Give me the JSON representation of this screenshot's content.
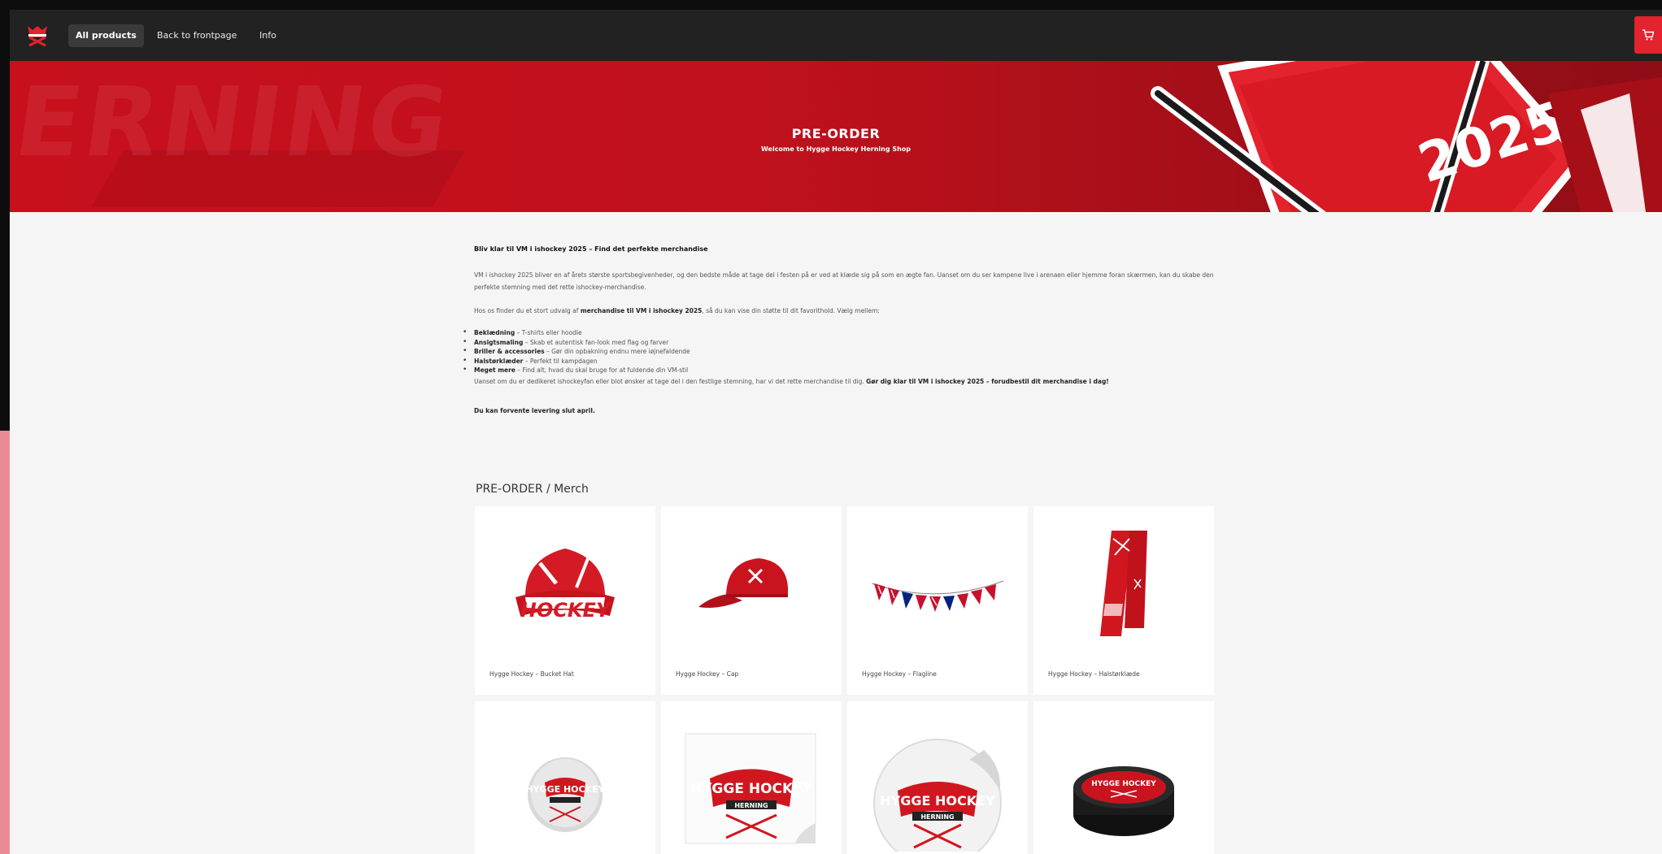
{
  "nav": {
    "links": [
      "All products",
      "Back to frontpage",
      "Info"
    ],
    "cart_icon": "cart-icon"
  },
  "hero": {
    "bg_text": "ERNING",
    "badge_year": "2025",
    "title": "PRE-ORDER",
    "subtitle": "Welcome to Hygge Hockey Herning Shop"
  },
  "intro": {
    "heading": "Bliv klar til VM i ishockey 2025 – Find det perfekte merchandise",
    "p1": "VM i ishockey 2025 bliver en af årets største sportsbegivenheder, og den bedste måde at tage del i festen på er ved at klæde sig på som en ægte fan. Uanset om du ser kampene live i arenaen eller hjemme foran skærmen, kan du skabe den perfekte stemning med det rette ishockey-merchandise.",
    "p2_before": "Hos os finder du et stort udvalg af ",
    "p2_bold": "merchandise til VM i ishockey 2025",
    "p2_after": ", så du kan vise din støtte til dit favorithold. Vælg mellem:",
    "items": [
      {
        "bold": "Beklædning",
        "text": " – T-shirts eller hoodie"
      },
      {
        "bold": "Ansigtsmaling",
        "text": " – Skab et autentisk fan-look med flag og farver"
      },
      {
        "bold": "Briller & accessories",
        "text": " – Gør din opbakning endnu mere iøjnefaldende"
      },
      {
        "bold": "Halstørklæder",
        "text": " – Perfekt til kampdagen"
      },
      {
        "bold": "Meget mere",
        "text": " – Find alt, hvad du skal bruge for at fuldende din VM-stil"
      }
    ],
    "closing_text": "Uanset om du er dedikeret ishockeyfan eller blot ønsker at tage del i den festlige stemning, har vi det rette merchandise til dig. ",
    "closing_bold": "Gør dig klar til VM i ishockey 2025 – forudbestil dit merchandise i dag!",
    "delivery": "Du kan forvente levering slut april."
  },
  "section": {
    "title": "PRE-ORDER / Merch"
  },
  "products": [
    {
      "name": "Hygge Hockey – Bucket Hat",
      "icon": "bucket-hat-image"
    },
    {
      "name": "Hygge Hockey – Cap",
      "icon": "cap-image"
    },
    {
      "name": "Hygge Hockey – Flagline",
      "icon": "flagline-image"
    },
    {
      "name": "Hygge Hockey – Halstørklæde",
      "icon": "scarf-image"
    },
    {
      "name": "",
      "icon": "button-badge-image"
    },
    {
      "name": "",
      "icon": "sticker-image"
    },
    {
      "name": "",
      "icon": "round-sticker-image"
    },
    {
      "name": "",
      "icon": "puck-image"
    }
  ],
  "logo_text": "HYGGE HOCKEY HERNING",
  "colors": {
    "nav_bg": "#222222",
    "brand_red": "#c8101d",
    "cart_red": "#e3232d",
    "page_bg": "#f5f5f5"
  }
}
